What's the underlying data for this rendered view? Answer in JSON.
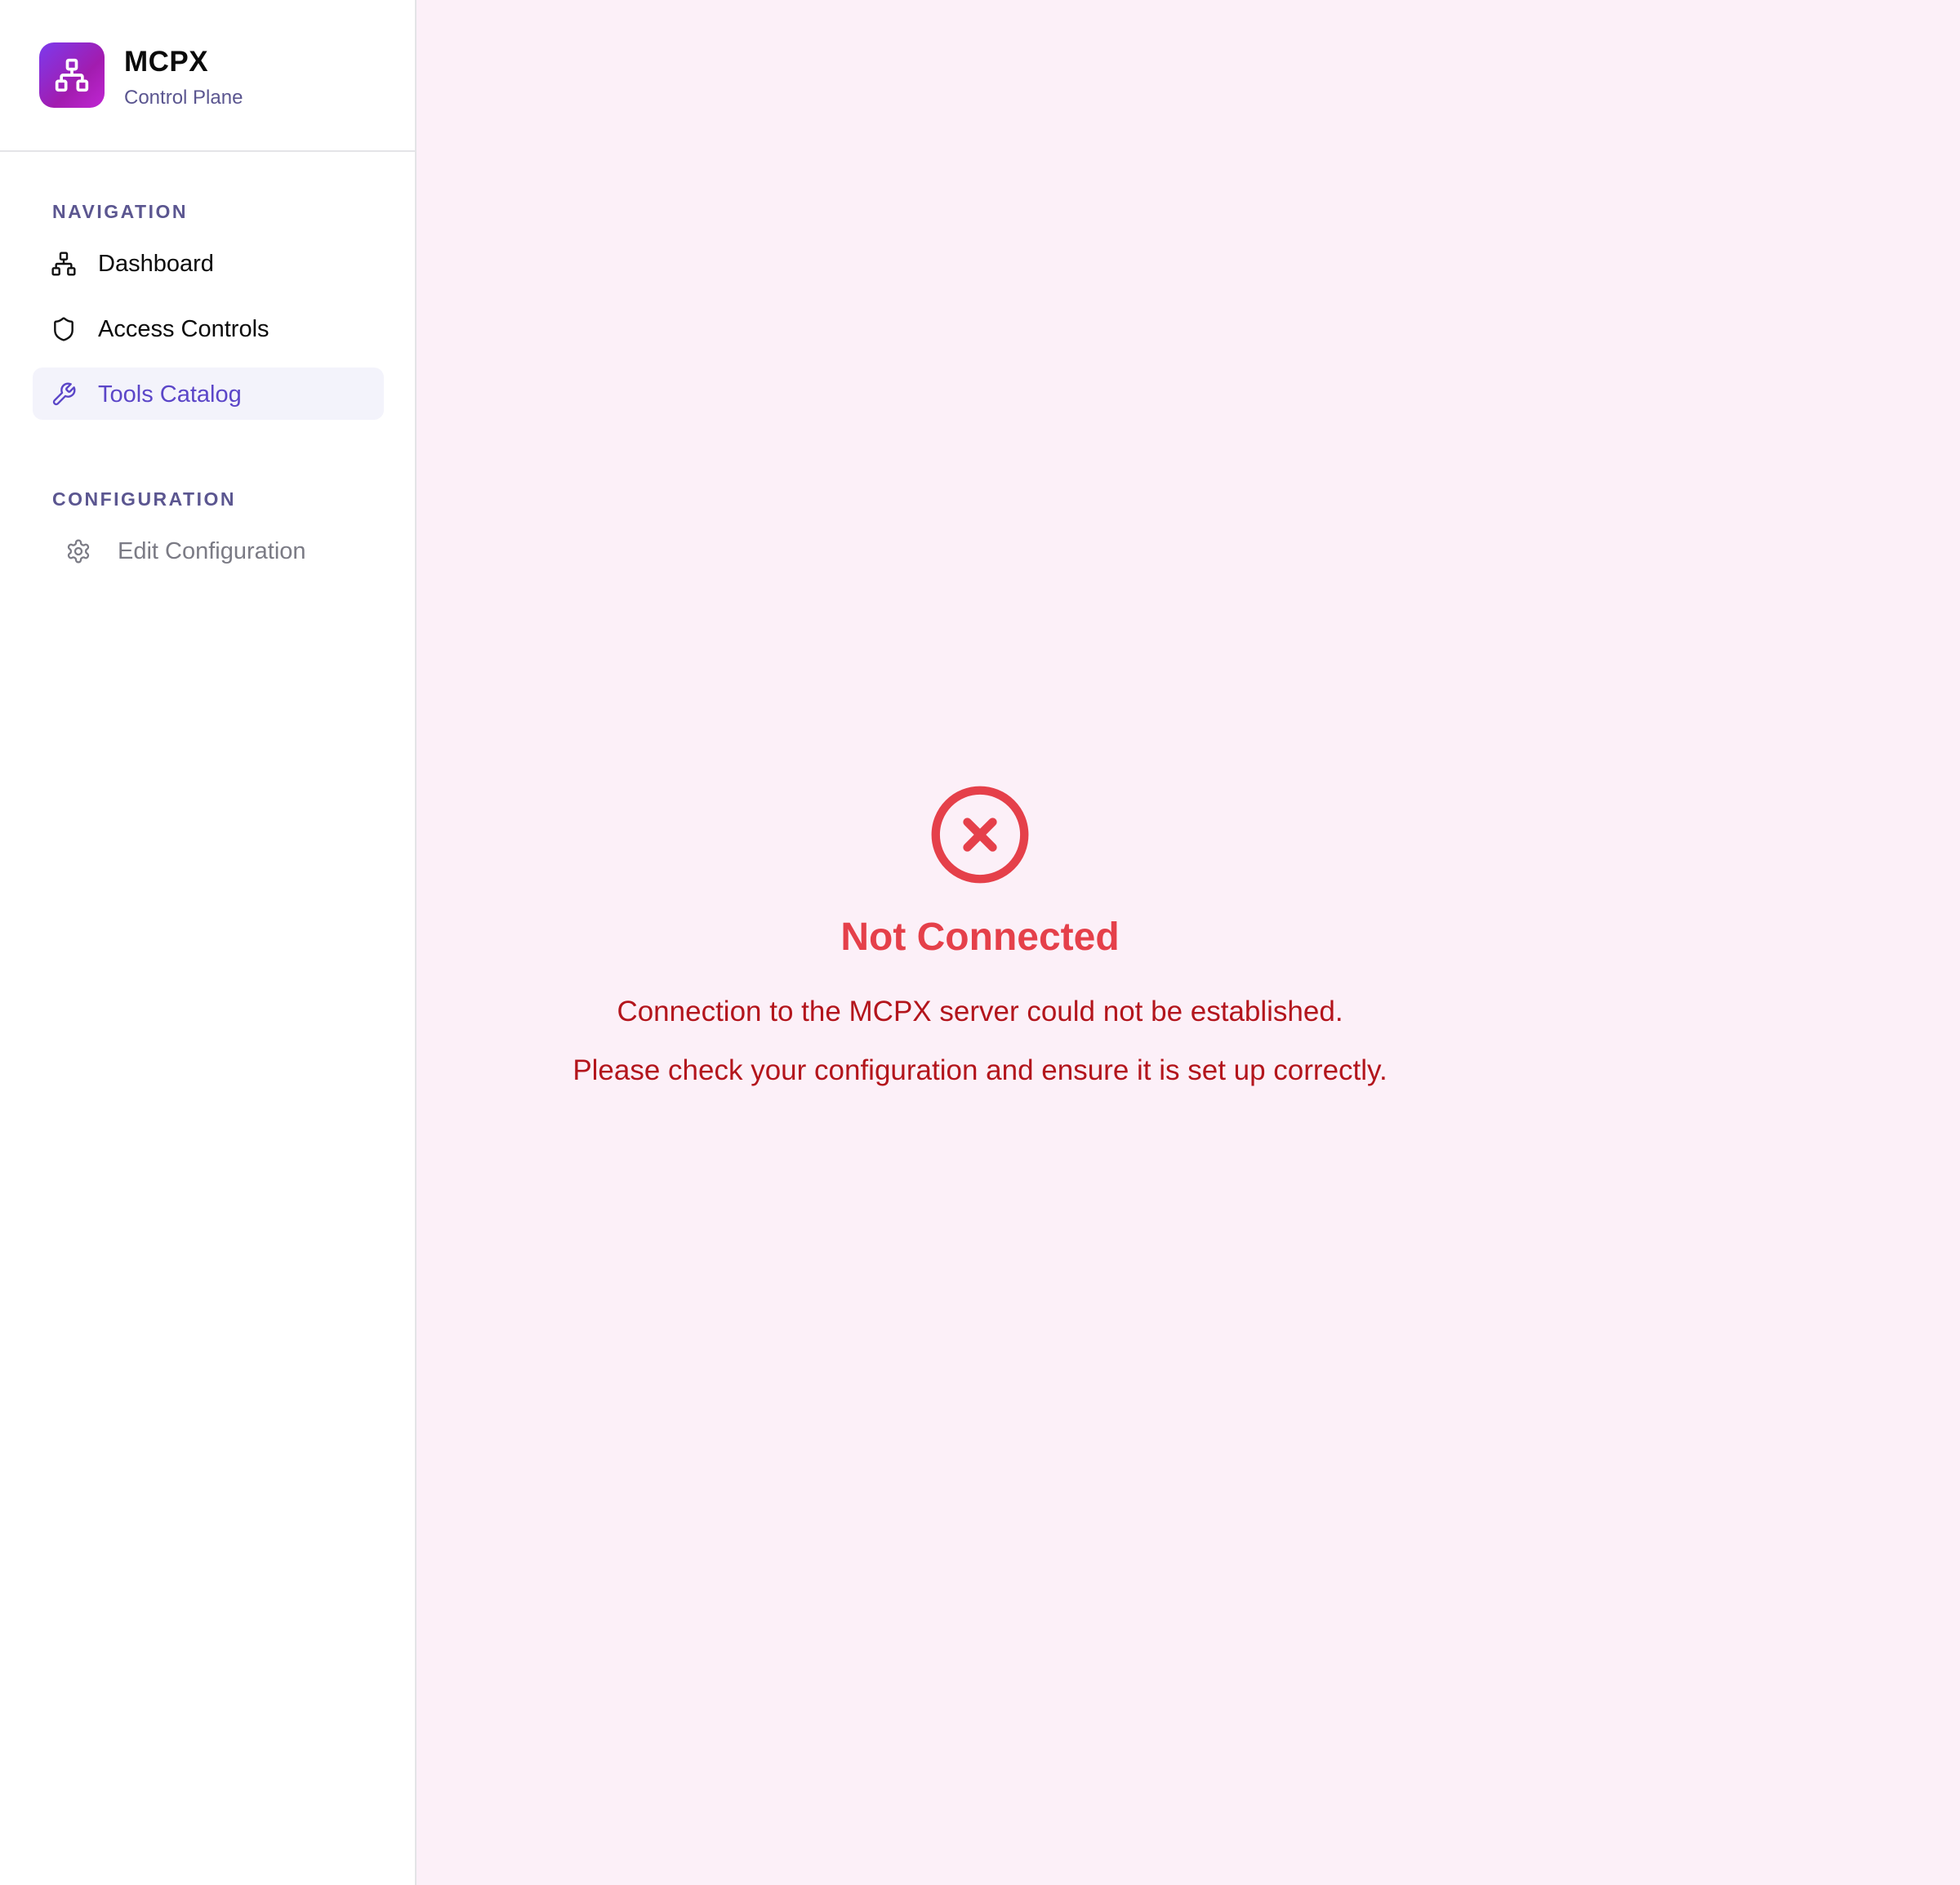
{
  "brand": {
    "title": "MCPX",
    "subtitle": "Control Plane",
    "logo_icon": "network-icon",
    "logo_gradient": [
      "#7c3aed",
      "#c026d3"
    ]
  },
  "sidebar": {
    "navigation_label": "NAVIGATION",
    "navigation_items": [
      {
        "label": "Dashboard",
        "icon": "network-icon",
        "active": false
      },
      {
        "label": "Access Controls",
        "icon": "shield-icon",
        "active": false
      },
      {
        "label": "Tools Catalog",
        "icon": "wrench-icon",
        "active": true
      }
    ],
    "configuration_label": "CONFIGURATION",
    "configuration_items": [
      {
        "label": "Edit Configuration",
        "icon": "gear-icon",
        "disabled": true
      }
    ]
  },
  "status": {
    "icon": "x-circle-icon",
    "title": "Not Connected",
    "line1": "Connection to the MCPX server could not be established.",
    "line2": "Please check your configuration and ensure it is set up correctly."
  },
  "colors": {
    "accent": "#5b46c8",
    "error": "#e5404a",
    "error_text": "#b3151c",
    "main_background": "#fcf0f8"
  }
}
